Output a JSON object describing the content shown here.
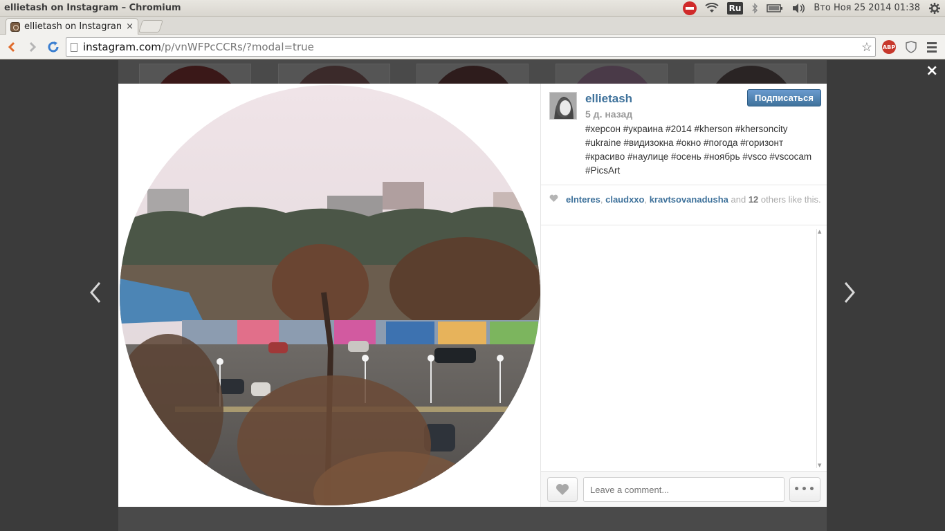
{
  "os": {
    "window_title": "ellietash on Instagram – Chromium",
    "keyboard_layout": "Ru",
    "clock": "Вто Ноя 25 2014 01:38",
    "icons": [
      "no-entry-icon",
      "wifi-icon",
      "bluetooth-icon",
      "battery-icon",
      "volume-icon",
      "gear-icon"
    ]
  },
  "browser": {
    "tab_title": "ellietash on Instagram",
    "tab_close": "×",
    "url_host": "instagram.com",
    "url_path": "/p/vnWFPcCCRs/?modal=true",
    "abp_label": "ABP"
  },
  "modal": {
    "close_label": "×",
    "prev_label": "‹",
    "next_label": "›",
    "username": "ellietash",
    "time_ago": "5 д. назад",
    "follow_label": "Подписаться",
    "caption": "#херсон #украина #2014 #kherson #khersoncity #ukraine #видизокна #окно #погода #горизонт #красиво #наулице #осень #ноябрь #vsco #vscocam #PicsArt",
    "likes": {
      "users": [
        "elnteres",
        "claudxxo",
        "kravtsovanadusha"
      ],
      "and_text": "and",
      "others_count": "12",
      "others_text": "others like this."
    },
    "comment_placeholder": "Leave a comment...",
    "more_label": "•••"
  }
}
